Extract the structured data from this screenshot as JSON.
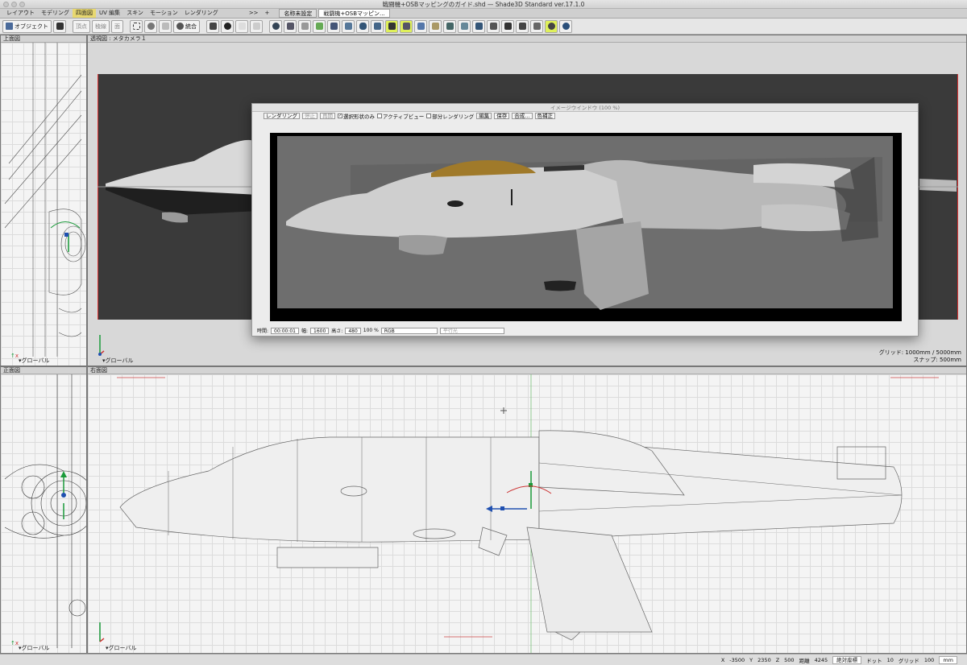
{
  "window": {
    "title": "戦闘機+OSBマッピングのガイド.shd — Shade3D Standard ver.17.1.0"
  },
  "mode_tabs": [
    "レイアウト",
    "モデリング",
    "四面図",
    "UV 編集",
    "スキン",
    "モーション",
    "レンダリング"
  ],
  "mode_tabs_active": 2,
  "overflow": ">>",
  "add_tab": "+",
  "doc_tabs": [
    "名称未設定",
    "戦闘機+OSBマッピン..."
  ],
  "toolbar": {
    "object_button": "オブジェクト",
    "vertex": "頂点",
    "edge": "稜線",
    "face": "面",
    "merge": "統合"
  },
  "viewports": {
    "top": {
      "label": "上面図",
      "global": "グローバル"
    },
    "perspective": {
      "label": "透視図 : メタカメラ１",
      "global": "グローバル",
      "grid_line1": "グリッド: 1000mm / 5000mm",
      "grid_line2": "スナップ: 500mm"
    },
    "front": {
      "label": "正面図",
      "global": "グローバル"
    },
    "right": {
      "label": "右面図",
      "global": "グローバル"
    }
  },
  "image_window": {
    "title": "イメージウインドウ (100 %)",
    "render_button": "レンダリング",
    "stop_button": "停止",
    "resume_button": "再開",
    "selected_only": "選択形状のみ",
    "active_view": "アクティブビュー",
    "partial_render": "部分レンダリング",
    "edit_button": "編集",
    "save_button": "保存",
    "composite_button": "合成...",
    "color_button": "色補正",
    "time_label": "時間:",
    "time_value": "00:00:01",
    "width_label": "幅:",
    "width_value": "1600",
    "height_label": "高さ:",
    "height_value": "480",
    "zoom": "100 %",
    "channel": "RGB",
    "projection": "平行光"
  },
  "status": {
    "x_label": "X",
    "x_value": "-3500",
    "y_label": "Y",
    "y_value": "2350",
    "z_label": "Z",
    "z_value": "500",
    "distance_label": "距離",
    "distance_value": "4245",
    "coord_mode": "絶対座標",
    "dot_label": "ドット",
    "dot_value": "10",
    "grid_label": "グリッド",
    "grid_value": "100",
    "unit": "mm"
  }
}
